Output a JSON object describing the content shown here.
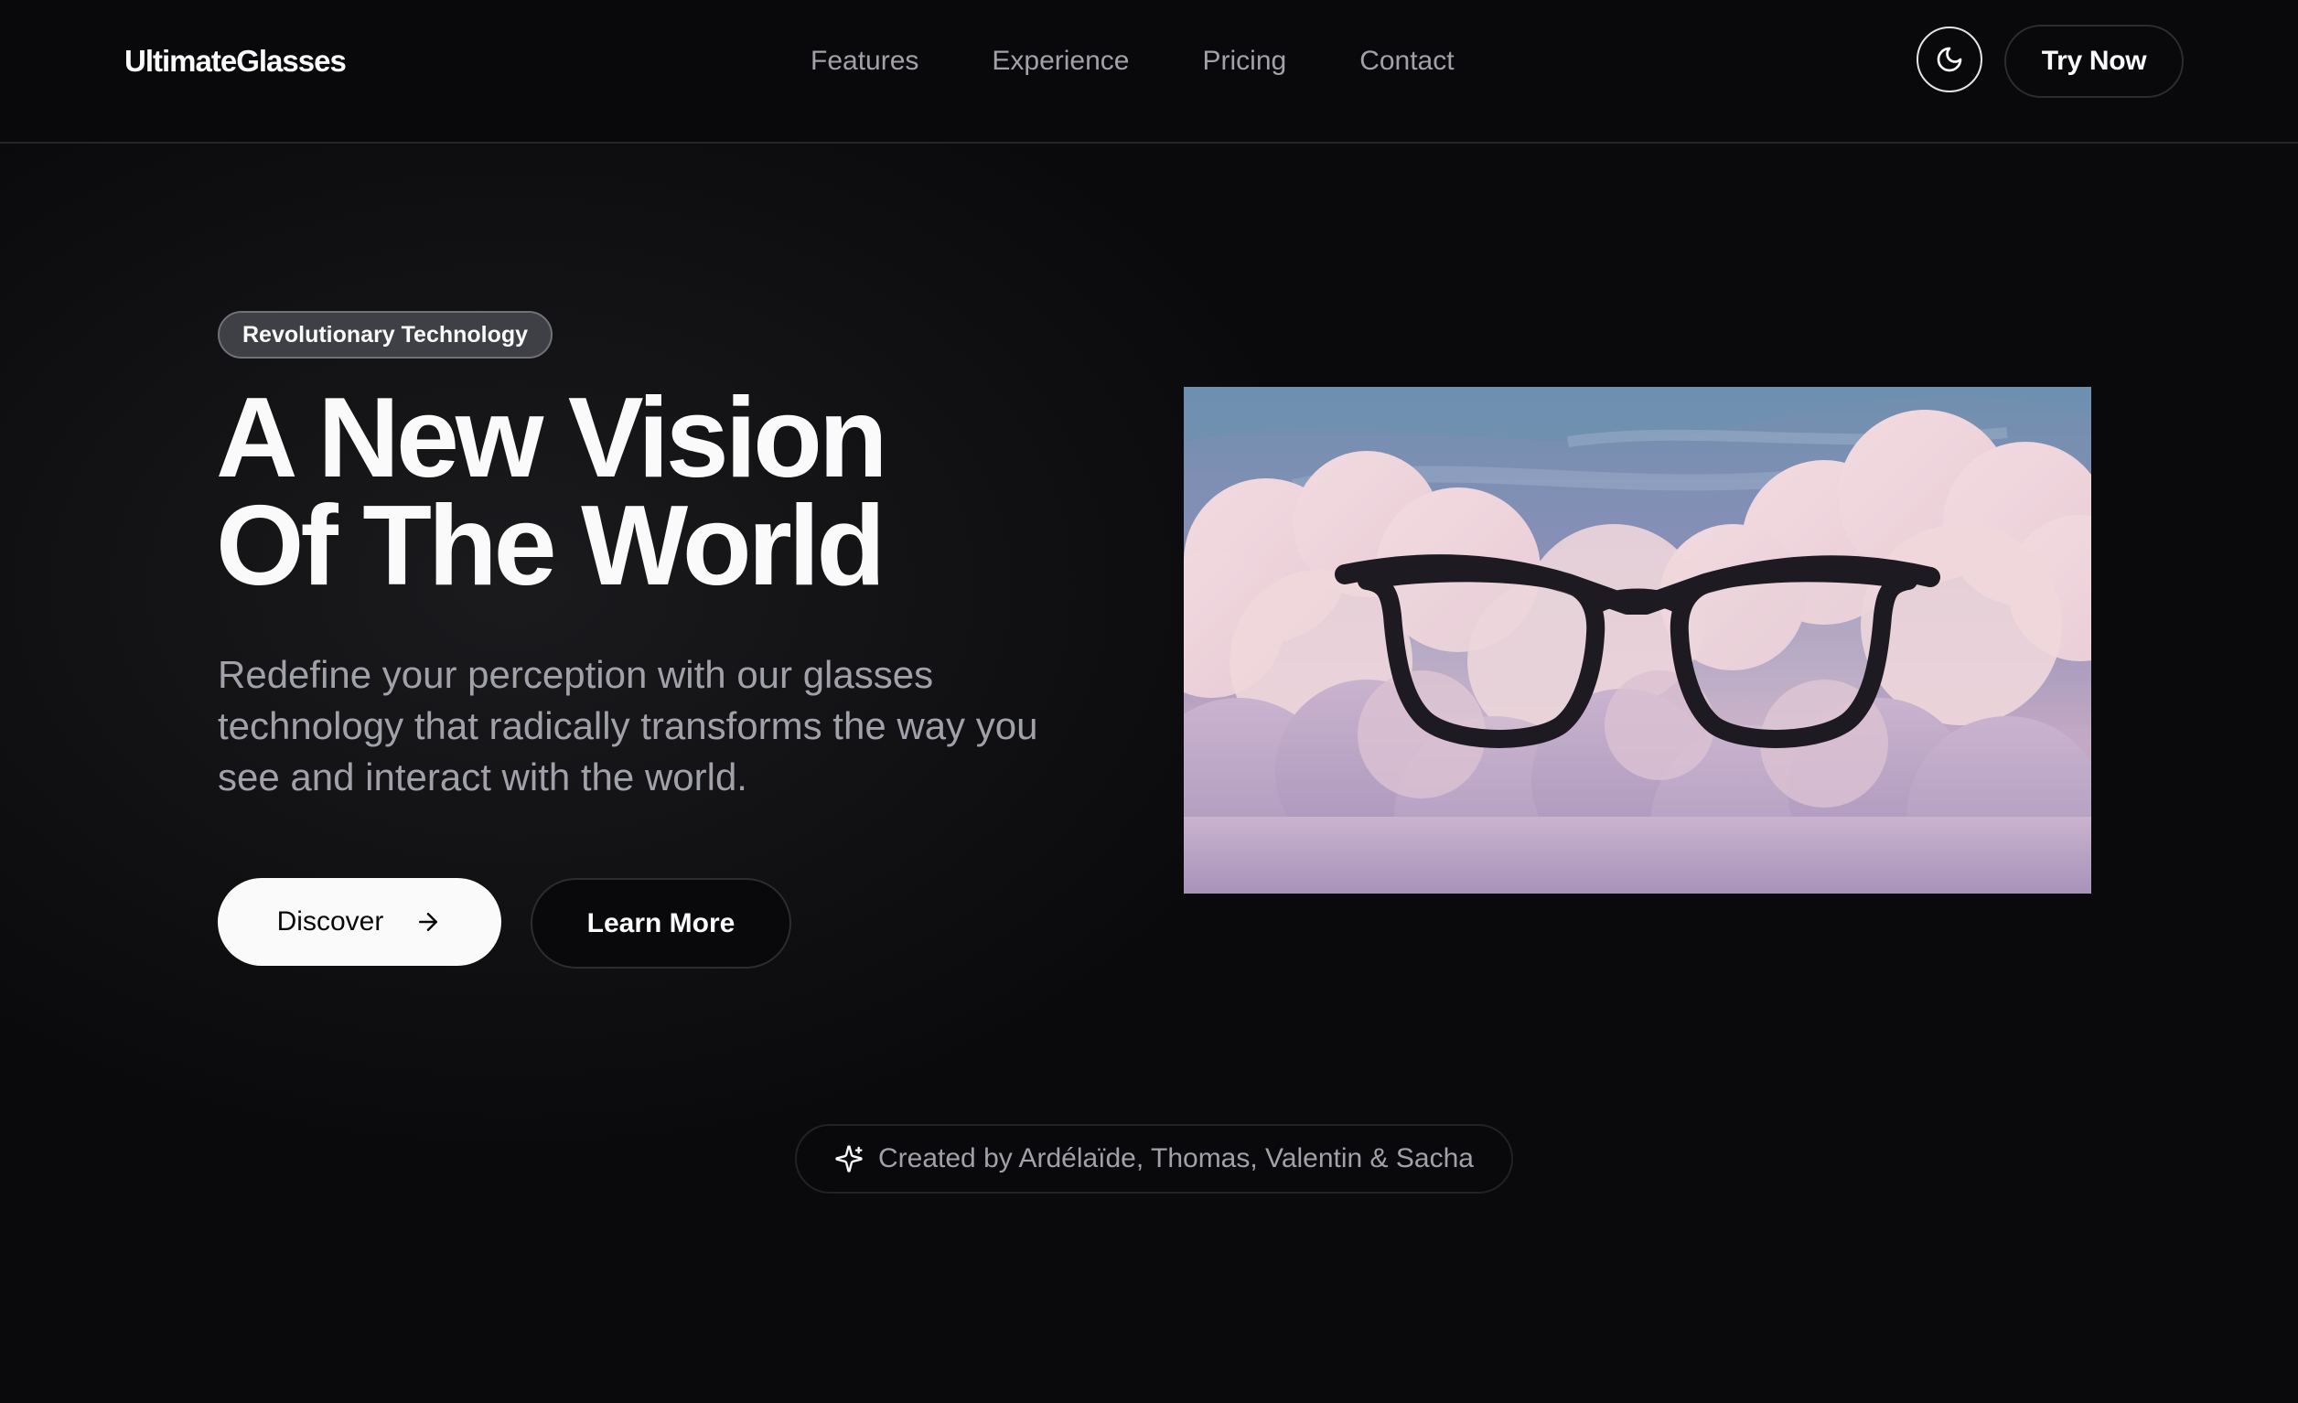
{
  "header": {
    "logo": "UltimateGlasses",
    "nav": [
      {
        "label": "Features"
      },
      {
        "label": "Experience"
      },
      {
        "label": "Pricing"
      },
      {
        "label": "Contact"
      }
    ],
    "theme_toggle_icon": "moon-icon",
    "cta_label": "Try Now"
  },
  "hero": {
    "badge": "Revolutionary Technology",
    "headline_line1": "A New Vision",
    "headline_line2": "Of The World",
    "subtitle": "Redefine your perception with our glasses technology that radically transforms the way you see and interact with the world.",
    "primary_button": "Discover",
    "primary_button_icon": "arrow-right-icon",
    "secondary_button": "Learn More",
    "image_icon": "glasses-in-clouds-illustration"
  },
  "credit": {
    "icon": "sparkles-icon",
    "text": "Created by Ardélaïde, Thomas, Valentin & Sacha"
  },
  "colors": {
    "background": "#0a0a0c",
    "text_primary": "#fafafa",
    "text_muted": "#a1a1aa",
    "badge_bg": "#3f3f46"
  }
}
